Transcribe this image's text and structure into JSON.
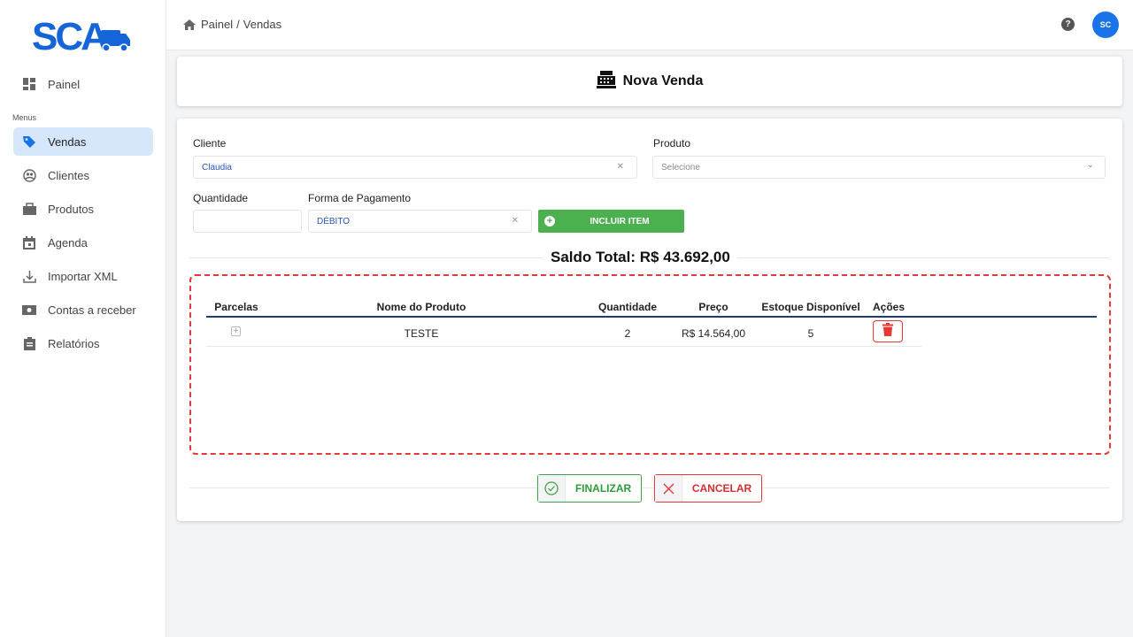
{
  "app": {
    "logo_text": "SCA"
  },
  "sidebar": {
    "menus_label": "Menus",
    "items": [
      {
        "label": "Painel",
        "icon": "dashboard-icon"
      },
      {
        "label": "Vendas",
        "icon": "tag-icon",
        "active": true
      },
      {
        "label": "Clientes",
        "icon": "clients-icon"
      },
      {
        "label": "Produtos",
        "icon": "bag-icon"
      },
      {
        "label": "Agenda",
        "icon": "calendar-icon"
      },
      {
        "label": "Importar XML",
        "icon": "import-icon"
      },
      {
        "label": "Contas a receber",
        "icon": "money-icon"
      },
      {
        "label": "Relatórios",
        "icon": "report-icon"
      }
    ]
  },
  "topbar": {
    "breadcrumb": [
      "Painel",
      "Vendas"
    ],
    "breadcrumb_sep": "/",
    "help_label": "?",
    "avatar_initials": "SC"
  },
  "page": {
    "title": "Nova Venda"
  },
  "form": {
    "cliente_label": "Cliente",
    "cliente_value": "Claudia",
    "produto_label": "Produto",
    "produto_placeholder": "Selecione",
    "quantidade_label": "Quantidade",
    "quantidade_value": "",
    "pagamento_label": "Forma de Pagamento",
    "pagamento_value": "DÉBITO",
    "incluir_label": "INCLUIR ITEM"
  },
  "saldo": "Saldo Total: R$ 43.692,00",
  "table": {
    "headers": [
      "Parcelas",
      "Nome do Produto",
      "Quantidade",
      "Preço",
      "Estoque Disponível",
      "Ações"
    ],
    "rows": [
      {
        "nome": "TESTE",
        "quantidade": "2",
        "preco": "R$ 14.564,00",
        "estoque": "5"
      }
    ]
  },
  "actions": {
    "finalizar": "FINALIZAR",
    "cancelar": "CANCELAR"
  },
  "colors": {
    "accent": "#1a73e8",
    "success": "#4caf50",
    "danger": "#e53935",
    "active_nav": "#d6e6fb"
  }
}
